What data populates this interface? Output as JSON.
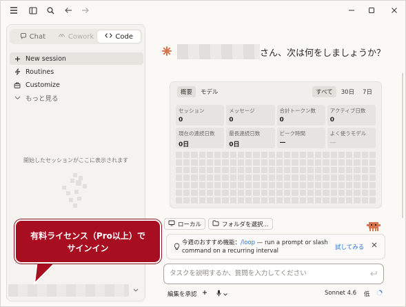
{
  "sidebar": {
    "tabs": [
      {
        "label": "Chat",
        "icon": "chat-bubble-icon"
      },
      {
        "label": "Cowork",
        "icon": "cowork-icon"
      },
      {
        "label": "Code",
        "icon": "code-icon"
      }
    ],
    "active_tab": "Code",
    "nav": [
      {
        "label": "New session",
        "icon": "plus-icon"
      },
      {
        "label": "Routines",
        "icon": "routine-icon"
      },
      {
        "label": "Customize",
        "icon": "briefcase-icon"
      },
      {
        "label": "もっと見る",
        "icon": "chevron-down-icon"
      }
    ],
    "empty_message": "開始したセッションがここに表示されます"
  },
  "main": {
    "greeting": "さん、次は何をしましょうか？",
    "stats": {
      "tabs": [
        "概要",
        "モデル"
      ],
      "ranges": [
        "すべて",
        "30日",
        "7日"
      ],
      "cells": [
        {
          "label": "セッション",
          "value": "0"
        },
        {
          "label": "メッセージ",
          "value": "0"
        },
        {
          "label": "合計トークン数",
          "value": "0"
        },
        {
          "label": "アクティブ日数",
          "value": "0"
        },
        {
          "label": "現在の連続日数",
          "value": "0日"
        },
        {
          "label": "最長連続日数",
          "value": "0日"
        },
        {
          "label": "ピーク時間",
          "value": "—"
        },
        {
          "label": "よく使うモデル",
          "value": "—"
        }
      ]
    },
    "location_buttons": [
      {
        "label": "ローカル",
        "icon": "monitor-icon"
      },
      {
        "label": "フォルダを選択...",
        "icon": "folder-icon"
      }
    ],
    "tip": {
      "prefix": "今週のおすすめ機能：",
      "link": "/loop",
      "rest": " — run a prompt or slash command on a recurring interval",
      "action": "試してみる"
    },
    "input_placeholder": "タスクを説明するか、質問を入力してください",
    "bottom_bar": {
      "permission": "編集を承認",
      "model": "Sonnet 4.6",
      "effort": "低"
    }
  },
  "callout": {
    "line1": "有料ライセンス（Pro以上）で",
    "line2": "サインイン"
  },
  "colors": {
    "accent": "#d9734d",
    "link": "#2f6fd0",
    "callout": "#a70e1f"
  }
}
